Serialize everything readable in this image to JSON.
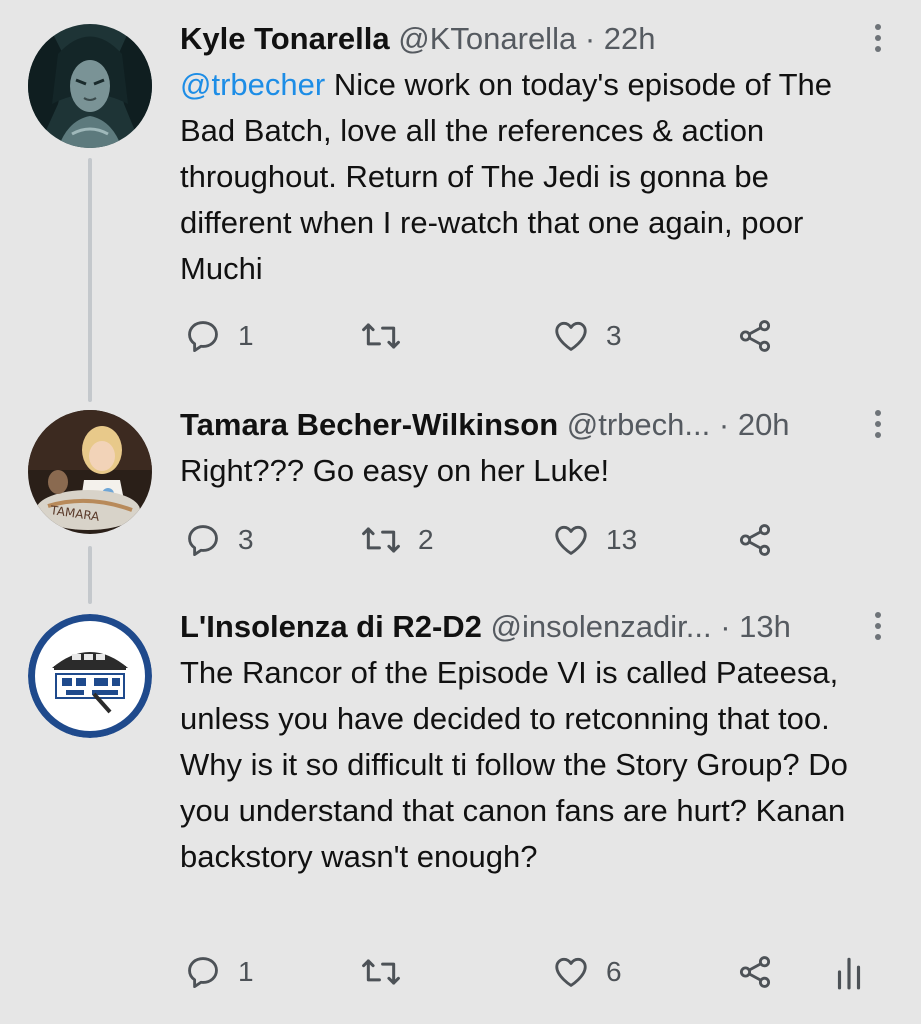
{
  "tweets": [
    {
      "name": "Kyle Tonarella",
      "handle": "@KTonarella",
      "separator": "·",
      "time": "22h",
      "mention": "@trbecher",
      "text": " Nice work on today's episode of The Bad Batch, love all the references & action throughout. Return of The Jedi is gonna be different when I re-watch that one again, poor Muchi",
      "replies": "1",
      "retweets": "",
      "likes": "3"
    },
    {
      "name": "Tamara Becher-Wilkinson",
      "handle": "@trbech...",
      "separator": "·",
      "time": "20h",
      "text": "Right??? Go easy on her Luke!",
      "replies": "3",
      "retweets": "2",
      "likes": "13"
    },
    {
      "name": "L'Insolenza di R2-D2",
      "handle": "@insolenzadir...",
      "separator": "·",
      "time": "13h",
      "text": "The Rancor of the Episode VI is called Pateesa, unless you have decided to retconning that too. Why is it so difficult ti follow the Story Group? Do you understand that canon fans are hurt? Kanan backstory wasn't enough?",
      "replies": "1",
      "retweets": "",
      "likes": "6"
    }
  ],
  "icons": {
    "reply": "reply-icon",
    "retweet": "retweet-icon",
    "like": "heart-icon",
    "share": "share-icon",
    "analytics": "analytics-icon",
    "more": "more-icon"
  },
  "colors": {
    "background": "#e6e6e6",
    "mention": "#1d8de6",
    "thread_line": "#c4c8cc",
    "icon": "#4d5257"
  }
}
